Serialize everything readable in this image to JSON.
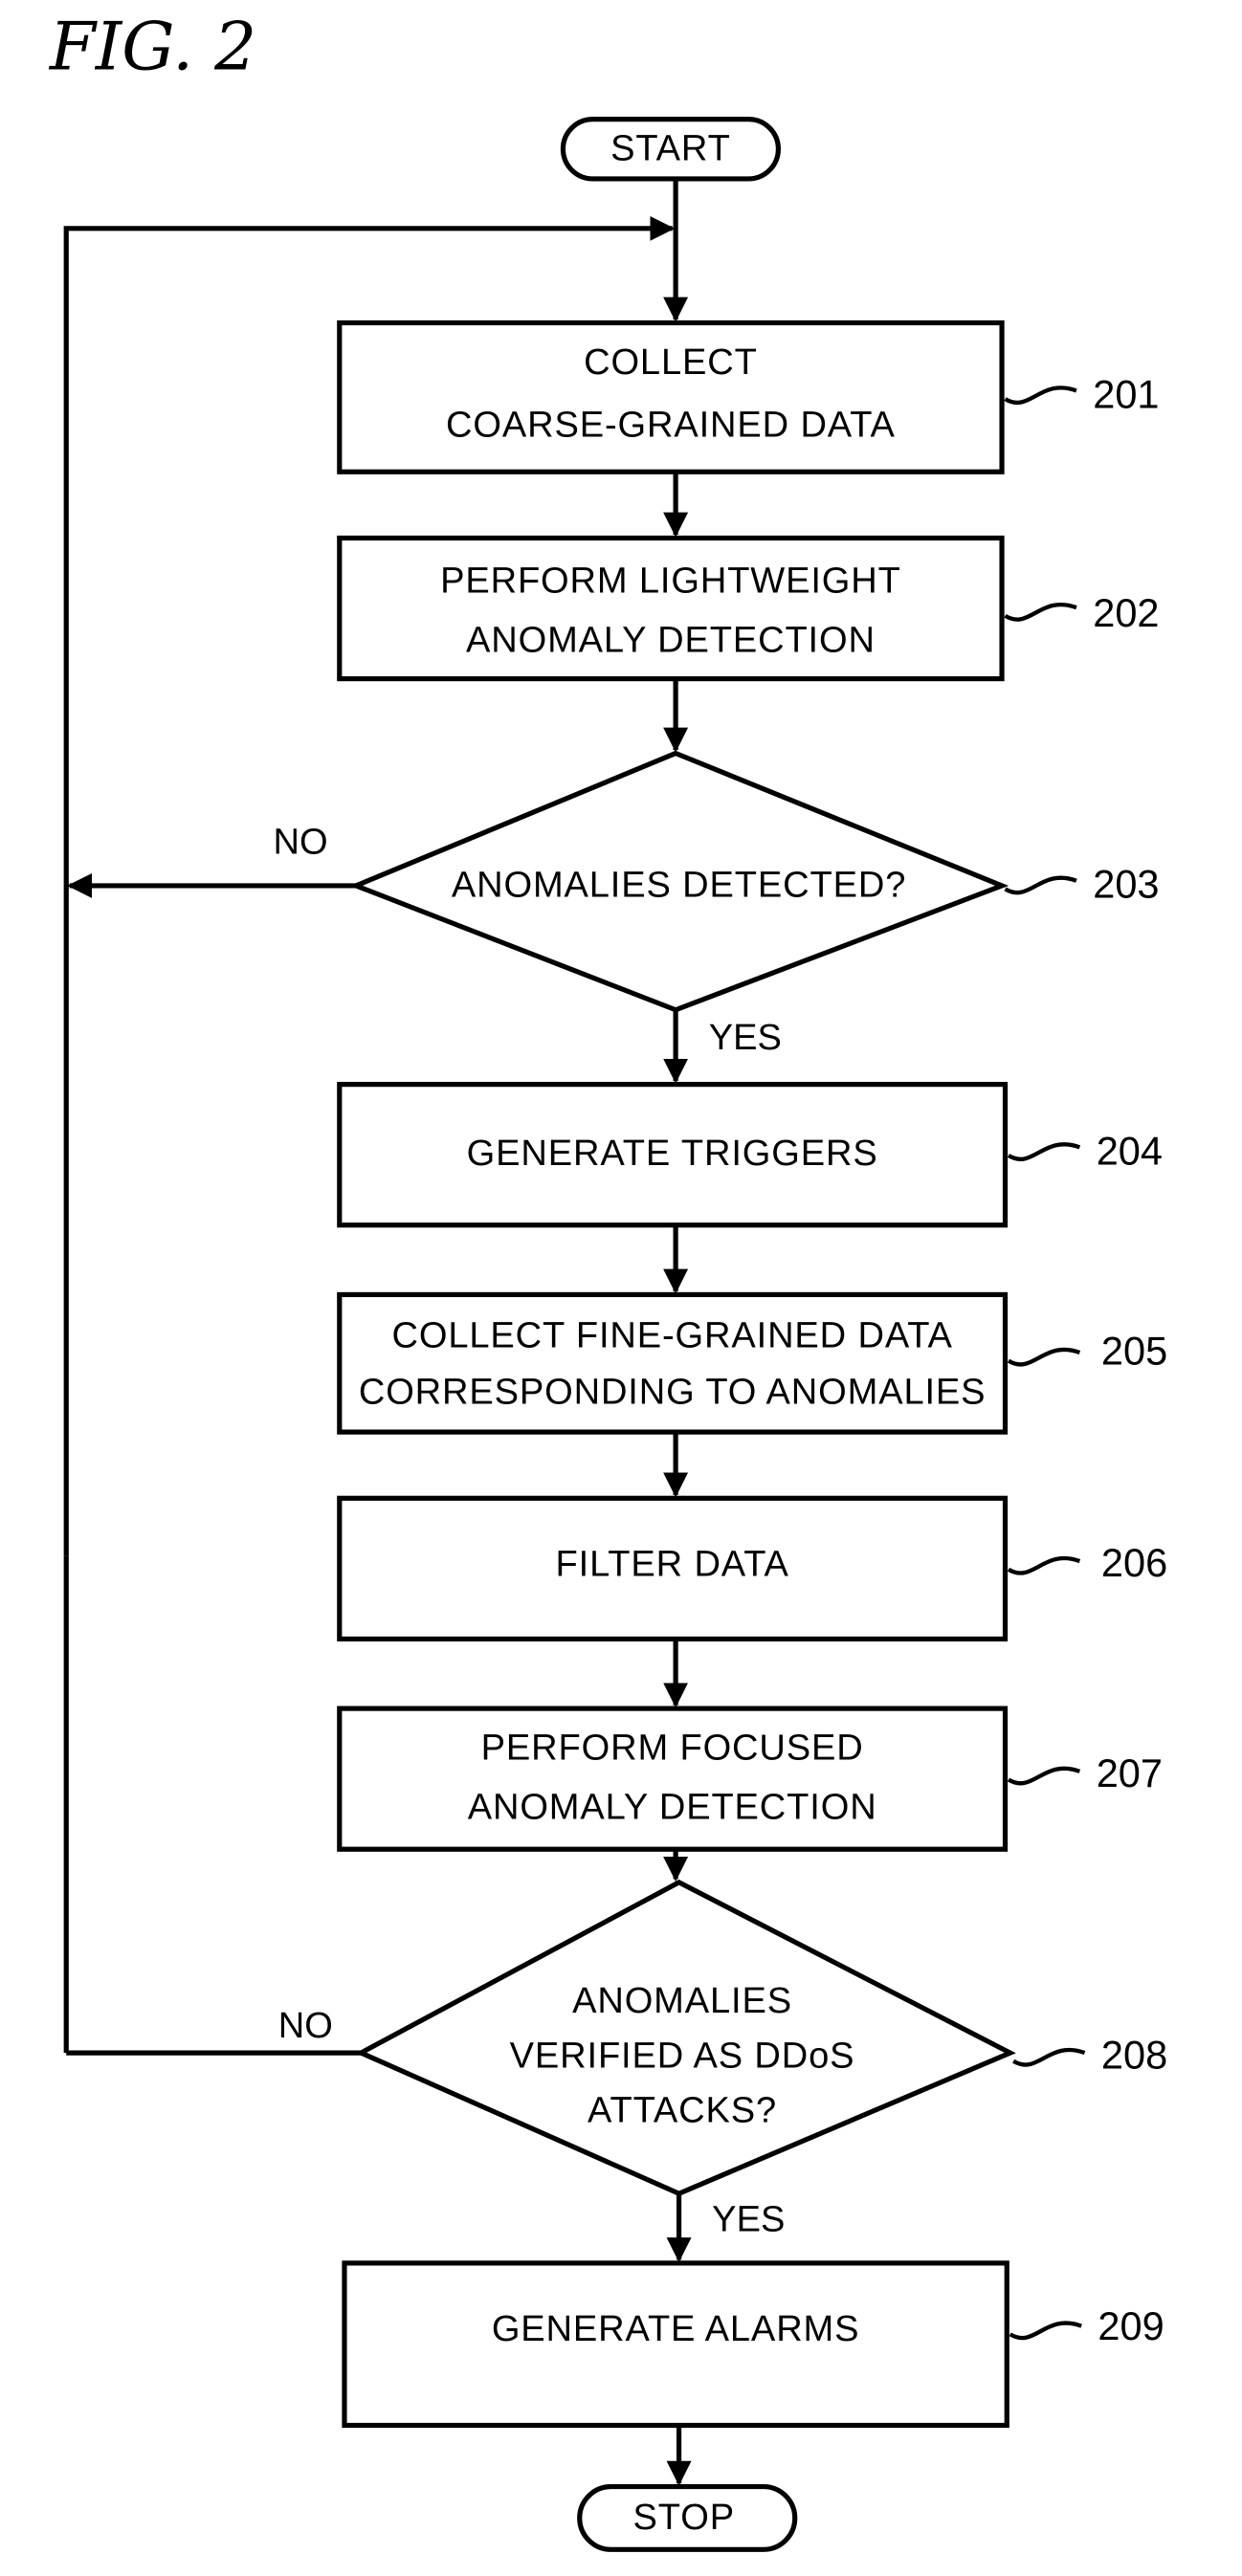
{
  "figure": {
    "title": "FIG. 2"
  },
  "terminals": {
    "start": "START",
    "stop": "STOP"
  },
  "steps": [
    {
      "ref": "201",
      "type": "process",
      "lines": [
        "COLLECT",
        "COARSE-GRAINED DATA"
      ]
    },
    {
      "ref": "202",
      "type": "process",
      "lines": [
        "PERFORM LIGHTWEIGHT",
        "ANOMALY DETECTION"
      ]
    },
    {
      "ref": "203",
      "type": "decision",
      "lines": [
        "ANOMALIES DETECTED?"
      ],
      "no_label": "NO",
      "yes_label": "YES"
    },
    {
      "ref": "204",
      "type": "process",
      "lines": [
        "GENERATE TRIGGERS"
      ]
    },
    {
      "ref": "205",
      "type": "process",
      "lines": [
        "COLLECT FINE-GRAINED DATA",
        "CORRESPONDING TO ANOMALIES"
      ]
    },
    {
      "ref": "206",
      "type": "process",
      "lines": [
        "FILTER DATA"
      ]
    },
    {
      "ref": "207",
      "type": "process",
      "lines": [
        "PERFORM FOCUSED",
        "ANOMALY DETECTION"
      ]
    },
    {
      "ref": "208",
      "type": "decision",
      "lines": [
        "ANOMALIES",
        "VERIFIED AS DDoS",
        "ATTACKS?"
      ],
      "no_label": "NO",
      "yes_label": "YES"
    },
    {
      "ref": "209",
      "type": "process",
      "lines": [
        "GENERATE ALARMS"
      ]
    }
  ]
}
